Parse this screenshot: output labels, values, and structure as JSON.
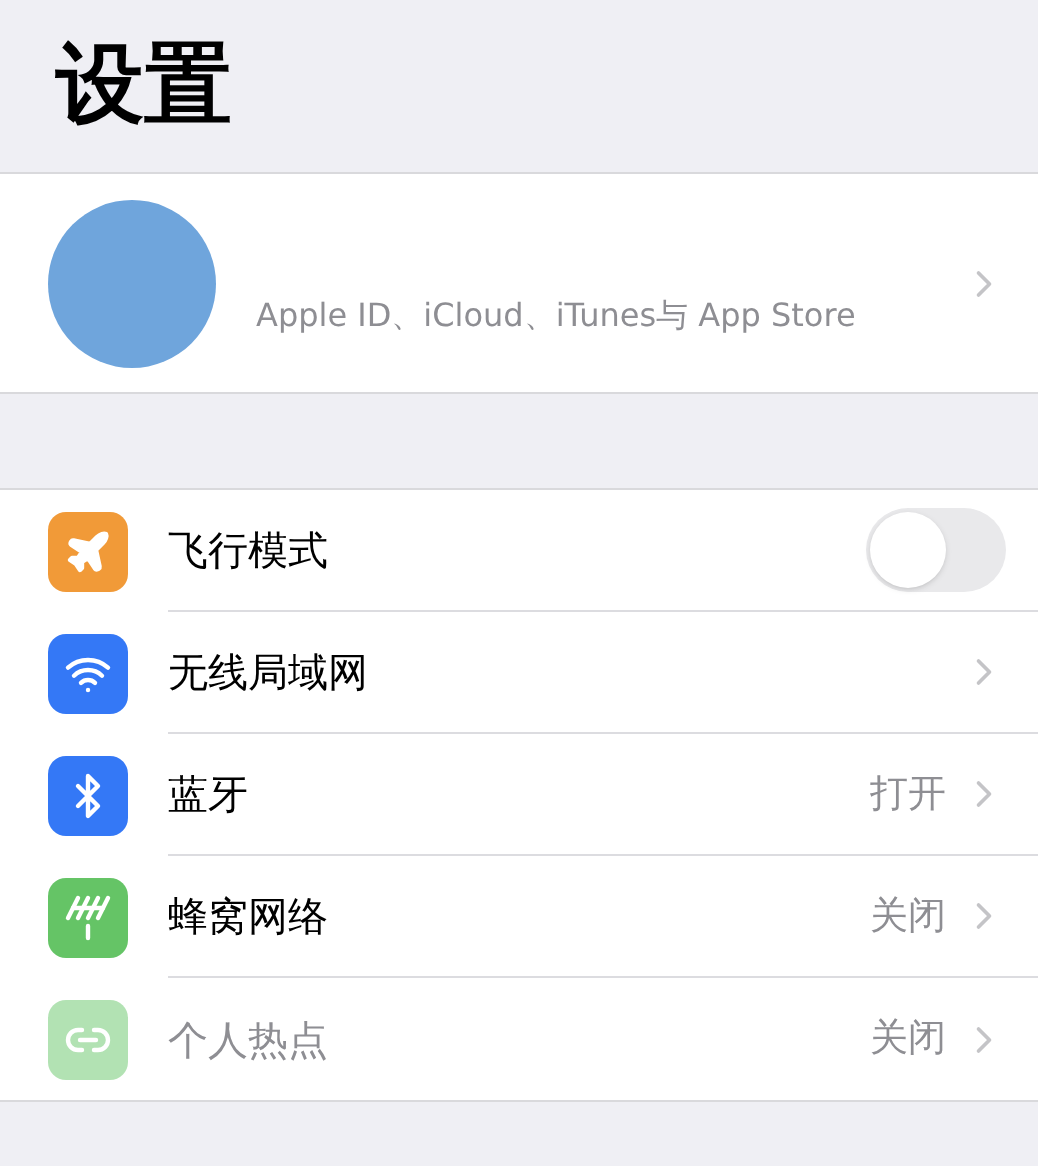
{
  "title": "设置",
  "profile": {
    "subtitle": "Apple ID、iCloud、iTunes与 App Store"
  },
  "rows": [
    {
      "kind": "toggle",
      "color": "#f19a38",
      "label": "飞行模式",
      "on": false,
      "disabled": false
    },
    {
      "kind": "link",
      "color": "#3478f6",
      "label": "无线局域网",
      "disabled": false
    },
    {
      "kind": "link",
      "color": "#3478f6",
      "label": "蓝牙",
      "value": "打开",
      "disabled": false
    },
    {
      "kind": "link",
      "color": "#65c466",
      "label": "蜂窝网络",
      "value": "关闭",
      "disabled": false
    },
    {
      "kind": "link",
      "color": "#b2e2b3",
      "label": "个人热点",
      "value": "关闭",
      "disabled": true
    }
  ]
}
